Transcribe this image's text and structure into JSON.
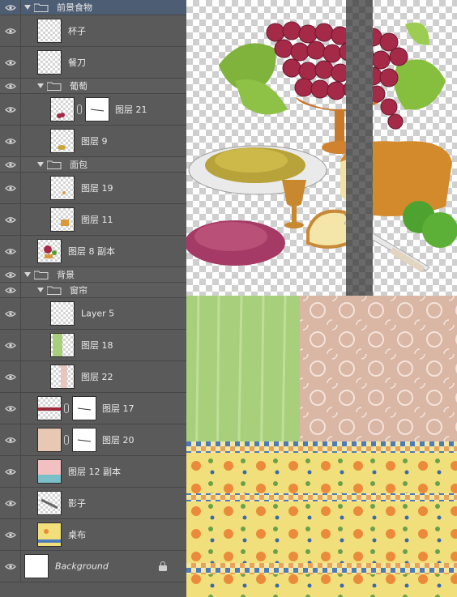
{
  "panel": {
    "layers": [
      {
        "id": "g-foreground",
        "kind": "group",
        "name": "前景食物",
        "indent": 0,
        "selected": true
      },
      {
        "id": "l-cup",
        "kind": "layer",
        "name": "杯子",
        "indent": 1,
        "thumb": "blank"
      },
      {
        "id": "l-knife",
        "kind": "layer",
        "name": "餐刀",
        "indent": 1,
        "thumb": "blank"
      },
      {
        "id": "g-grape",
        "kind": "group",
        "name": "葡萄",
        "indent": 1
      },
      {
        "id": "l-21",
        "kind": "layer",
        "name": "图层 21",
        "indent": 2,
        "thumb": "grape",
        "mask": true
      },
      {
        "id": "l-9",
        "kind": "layer",
        "name": "图层 9",
        "indent": 2,
        "thumb": "raisin"
      },
      {
        "id": "g-bread",
        "kind": "group",
        "name": "面包",
        "indent": 1
      },
      {
        "id": "l-19",
        "kind": "layer",
        "name": "图层 19",
        "indent": 2,
        "thumb": "crumbs"
      },
      {
        "id": "l-11",
        "kind": "layer",
        "name": "图层 11",
        "indent": 2,
        "thumb": "bread"
      },
      {
        "id": "l-8copy",
        "kind": "layer",
        "name": "图层 8 副本",
        "indent": 1,
        "thumb": "fruit"
      },
      {
        "id": "g-bg",
        "kind": "group",
        "name": "背景",
        "indent": 0
      },
      {
        "id": "g-curtain",
        "kind": "group",
        "name": "窗帘",
        "indent": 1
      },
      {
        "id": "l-5",
        "kind": "layer",
        "name": "Layer 5",
        "indent": 2,
        "thumb": "blank"
      },
      {
        "id": "l-18",
        "kind": "layer",
        "name": "图层 18",
        "indent": 2,
        "thumb": "curtain"
      },
      {
        "id": "l-22",
        "kind": "layer",
        "name": "图层 22",
        "indent": 2,
        "thumb": "pink"
      },
      {
        "id": "l-17",
        "kind": "layer",
        "name": "图层 17",
        "indent": 1,
        "thumb": "stripe",
        "mask": true
      },
      {
        "id": "l-20",
        "kind": "layer",
        "name": "图层 20",
        "indent": 1,
        "thumb": "lace",
        "mask": true
      },
      {
        "id": "l-12copy",
        "kind": "layer",
        "name": "图层 12 副本",
        "indent": 1,
        "thumb": "wall"
      },
      {
        "id": "l-shadow",
        "kind": "layer",
        "name": "影子",
        "indent": 1,
        "thumb": "shadow"
      },
      {
        "id": "l-cloth",
        "kind": "layer",
        "name": "桌布",
        "indent": 1,
        "thumb": "cloth"
      },
      {
        "id": "l-bg",
        "kind": "background",
        "name": "Background",
        "indent": 0,
        "thumb": "white",
        "locked": true
      }
    ]
  },
  "icons": {
    "visibility": "eye-icon",
    "group": "folder-icon",
    "expand": "triangle-down-icon",
    "link": "chain-link-icon",
    "lock": "lock-icon"
  },
  "colors": {
    "panel_bg": "#595959",
    "selected_row": "#4d5d73",
    "text": "#e8e8e8",
    "curtain": "#a8cf7c",
    "wall": "#dcb8a8",
    "tablecloth": "#f3e07a"
  }
}
